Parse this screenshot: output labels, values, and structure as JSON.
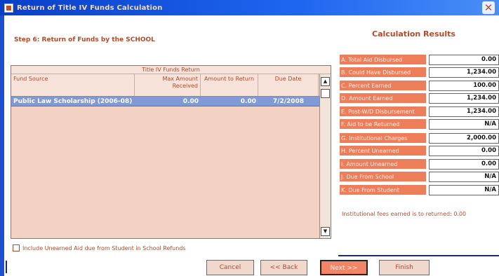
{
  "window": {
    "title": "Return of Title IV Funds Calculation"
  },
  "step_label": "Step 6: Return of Funds by the SCHOOL",
  "refund_table": {
    "caption": "Title IV Funds Return",
    "headers": {
      "fund_source": "Fund Source",
      "max_amount": "Max Amount Received",
      "amount_to_return": "Amount to Return",
      "due_date": "Due Date"
    },
    "rows": [
      {
        "fund_source": "Public Law Scholarship (2006-08)",
        "max_amount": "0.00",
        "amount_to_return": "0.00",
        "due_date": "7/2/2008"
      }
    ]
  },
  "include_unearned_checkbox": {
    "label": "Include Unearned Aid due from Student in School Refunds",
    "checked": false
  },
  "calculation_results": {
    "title": "Calculation Results",
    "rows": [
      {
        "label": "A. Total Aid Disbursed",
        "value": "0.00"
      },
      {
        "label": "B. Could Have Disbursed",
        "value": "1,234.00"
      },
      {
        "label": "C. Percent Earned",
        "value": "100.00"
      },
      {
        "label": "D. Amount Earned",
        "value": "1,234.00"
      },
      {
        "label": "E. Post-W/D Disbursement",
        "value": "1,234.00"
      },
      {
        "label": "F. Aid to be Returned",
        "value": "N/A"
      },
      {
        "label": "G. Institutional Charges",
        "value": "2,000.00"
      },
      {
        "label": "H. Percent Unearned",
        "value": "0.00"
      },
      {
        "label": "I. Amount Unearned",
        "value": "0.00"
      },
      {
        "label": "J. Due From School",
        "value": "N/A"
      },
      {
        "label": "K. Due From Student",
        "value": "N/A"
      }
    ],
    "note": "Institutional fees earned is to returned: 0.00"
  },
  "buttons": {
    "cancel": "Cancel",
    "back": "<< Back",
    "next": "Next >>",
    "finish": "Finish"
  },
  "colors": {
    "title_bar": "#1e66f0",
    "label_cell": "#ee7d5a",
    "selected_row": "#7f9ad6",
    "text_accent": "#b34a2a"
  }
}
